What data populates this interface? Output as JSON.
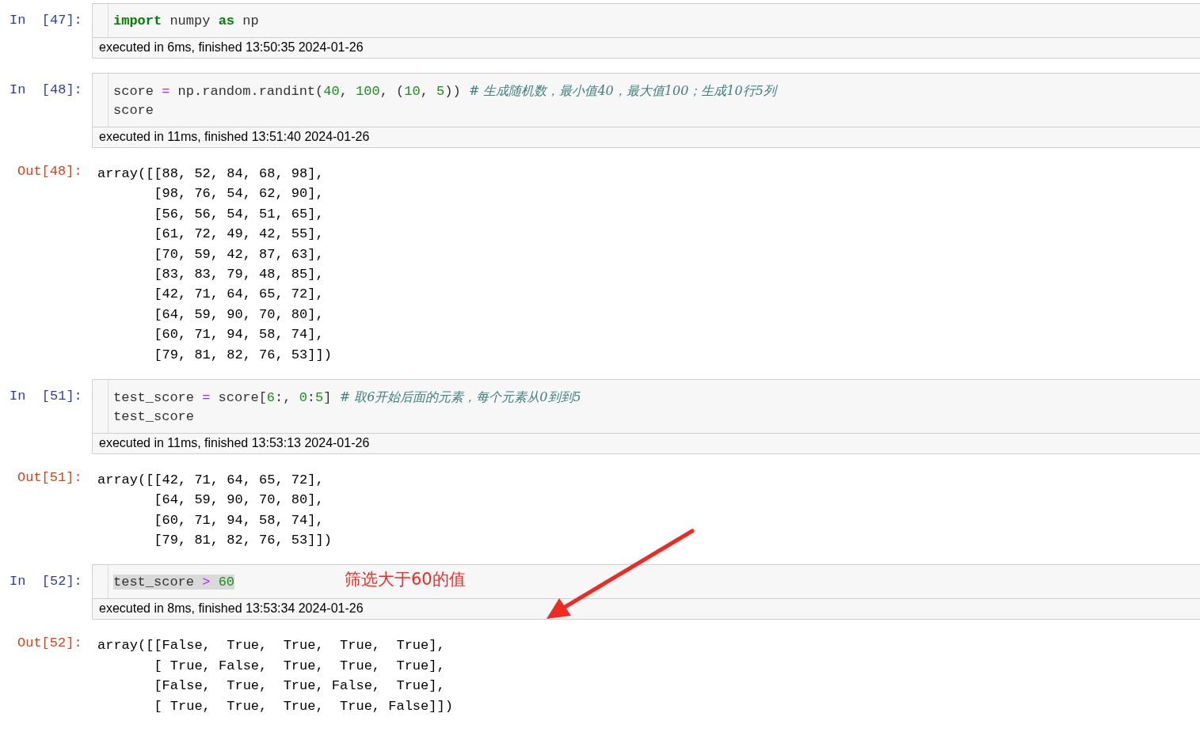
{
  "cells": [
    {
      "prompt": "In  [47]:",
      "code": [
        {
          "highlighted": false,
          "tokens": [
            {
              "kind": "kw",
              "t": "import"
            },
            {
              "kind": "plain",
              "t": " numpy "
            },
            {
              "kind": "kw",
              "t": "as"
            },
            {
              "kind": "plain",
              "t": " np"
            }
          ]
        }
      ],
      "exec": "executed in 6ms, finished 13:50:35 2024-01-26"
    },
    {
      "prompt": "In  [48]:",
      "code": [
        {
          "highlighted": false,
          "tokens": [
            {
              "kind": "plain",
              "t": "score "
            },
            {
              "kind": "op",
              "t": "="
            },
            {
              "kind": "plain",
              "t": " np.random.randint("
            },
            {
              "kind": "num",
              "t": "40"
            },
            {
              "kind": "plain",
              "t": ", "
            },
            {
              "kind": "num",
              "t": "100"
            },
            {
              "kind": "plain",
              "t": ", ("
            },
            {
              "kind": "num",
              "t": "10"
            },
            {
              "kind": "plain",
              "t": ", "
            },
            {
              "kind": "num",
              "t": "5"
            },
            {
              "kind": "plain",
              "t": ")) "
            },
            {
              "kind": "cmt",
              "t": "# 生成随机数，最小值40，最大值100；生成10行5列"
            }
          ]
        },
        {
          "highlighted": false,
          "tokens": [
            {
              "kind": "plain",
              "t": "score"
            }
          ]
        }
      ],
      "exec": "executed in 11ms, finished 13:51:40 2024-01-26",
      "out_prompt": "Out[48]:",
      "output": [
        "array([[88, 52, 84, 68, 98],",
        "       [98, 76, 54, 62, 90],",
        "       [56, 56, 54, 51, 65],",
        "       [61, 72, 49, 42, 55],",
        "       [70, 59, 42, 87, 63],",
        "       [83, 83, 79, 48, 85],",
        "       [42, 71, 64, 65, 72],",
        "       [64, 59, 90, 70, 80],",
        "       [60, 71, 94, 58, 74],",
        "       [79, 81, 82, 76, 53]])"
      ]
    },
    {
      "prompt": "In  [51]:",
      "code": [
        {
          "highlighted": false,
          "tokens": [
            {
              "kind": "plain",
              "t": "test_score "
            },
            {
              "kind": "op",
              "t": "="
            },
            {
              "kind": "plain",
              "t": " score["
            },
            {
              "kind": "num",
              "t": "6"
            },
            {
              "kind": "plain",
              "t": ":, "
            },
            {
              "kind": "num",
              "t": "0"
            },
            {
              "kind": "plain",
              "t": ":"
            },
            {
              "kind": "num",
              "t": "5"
            },
            {
              "kind": "plain",
              "t": "] "
            },
            {
              "kind": "cmt",
              "t": "# 取6开始后面的元素，每个元素从0到到5"
            }
          ]
        },
        {
          "highlighted": false,
          "tokens": [
            {
              "kind": "plain",
              "t": "test_score"
            }
          ]
        }
      ],
      "exec": "executed in 11ms, finished 13:53:13 2024-01-26",
      "out_prompt": "Out[51]:",
      "output": [
        "array([[42, 71, 64, 65, 72],",
        "       [64, 59, 90, 70, 80],",
        "       [60, 71, 94, 58, 74],",
        "       [79, 81, 82, 76, 53]])"
      ]
    },
    {
      "prompt": "In  [52]:",
      "code": [
        {
          "highlighted": true,
          "tokens": [
            {
              "kind": "plain",
              "t": "test_score "
            },
            {
              "kind": "op",
              "t": "> "
            },
            {
              "kind": "num",
              "t": "60"
            }
          ]
        }
      ],
      "annotation": "筛选大于60的值",
      "exec": "executed in 8ms, finished 13:53:34 2024-01-26",
      "out_prompt": "Out[52]:",
      "output": [
        "array([[False,  True,  True,  True,  True],",
        "       [ True, False,  True,  True,  True],",
        "       [False,  True,  True, False,  True],",
        "       [ True,  True,  True,  True, False]])"
      ]
    }
  ]
}
